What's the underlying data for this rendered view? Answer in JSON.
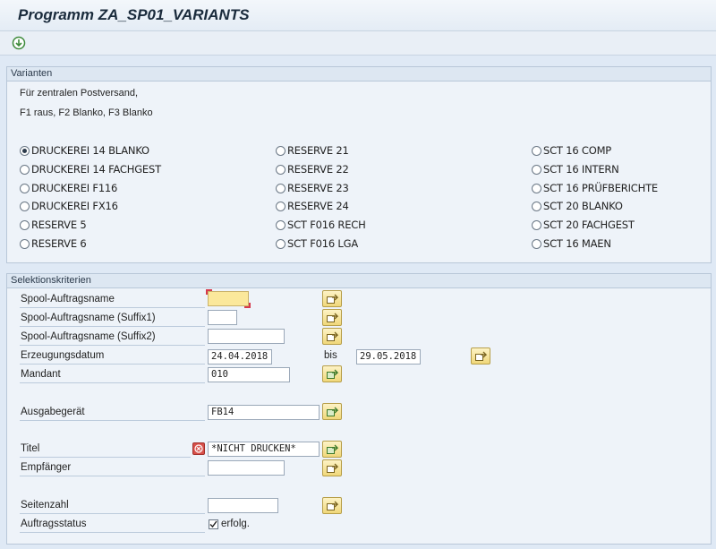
{
  "window": {
    "title": "Programm ZA_SP01_VARIANTS"
  },
  "toolbar": {
    "execute_icon": "execute-icon"
  },
  "variants": {
    "header": "Varianten",
    "description_line1": "Für zentralen Postversand,",
    "description_line2": "F1 raus, F2 Blanko, F3 Blanko",
    "selected": "DRUCKEREI 14 BLANKO",
    "col1": [
      "DRUCKEREI 14 BLANKO",
      "DRUCKEREI 14 FACHGEST",
      "DRUCKEREI F116",
      "DRUCKEREI FX16",
      "RESERVE 5",
      "RESERVE 6"
    ],
    "col2": [
      "RESERVE 21",
      "RESERVE 22",
      "RESERVE 23",
      "RESERVE 24",
      "SCT F016 RECH",
      "SCT F016 LGA"
    ],
    "col3": [
      "SCT 16 COMP",
      "SCT 16 INTERN",
      "SCT 16 PRÜFBERICHTE",
      "SCT 20 BLANKO",
      "SCT 20 FACHGEST",
      "SCT 16 MAEN"
    ]
  },
  "selection": {
    "header": "Selektionskriterien",
    "spool_name_label": "Spool-Auftragsname",
    "spool_name_value": "",
    "suffix1_label": "Spool-Auftragsname (Suffix1)",
    "suffix1_value": "",
    "suffix2_label": "Spool-Auftragsname (Suffix2)",
    "suffix2_value": "",
    "date_label": "Erzeugungsdatum",
    "date_from": "24.04.2018",
    "date_to_label": "bis",
    "date_to": "29.05.2018",
    "client_label": "Mandant",
    "client_value": "010",
    "device_label": "Ausgabegerät",
    "device_value": "FB14",
    "title_label": "Titel",
    "title_value": "*NICHT DRUCKEN*",
    "recipient_label": "Empfänger",
    "recipient_value": "",
    "pages_label": "Seitenzahl",
    "pages_value": "",
    "status_label": "Auftragsstatus",
    "status_checkbox_label": "erfolg.",
    "status_checked": true
  },
  "colors": {
    "accent": "#f0d77a",
    "background": "#dfe9f5",
    "required": "#fbe89b",
    "error": "#d8504a"
  }
}
